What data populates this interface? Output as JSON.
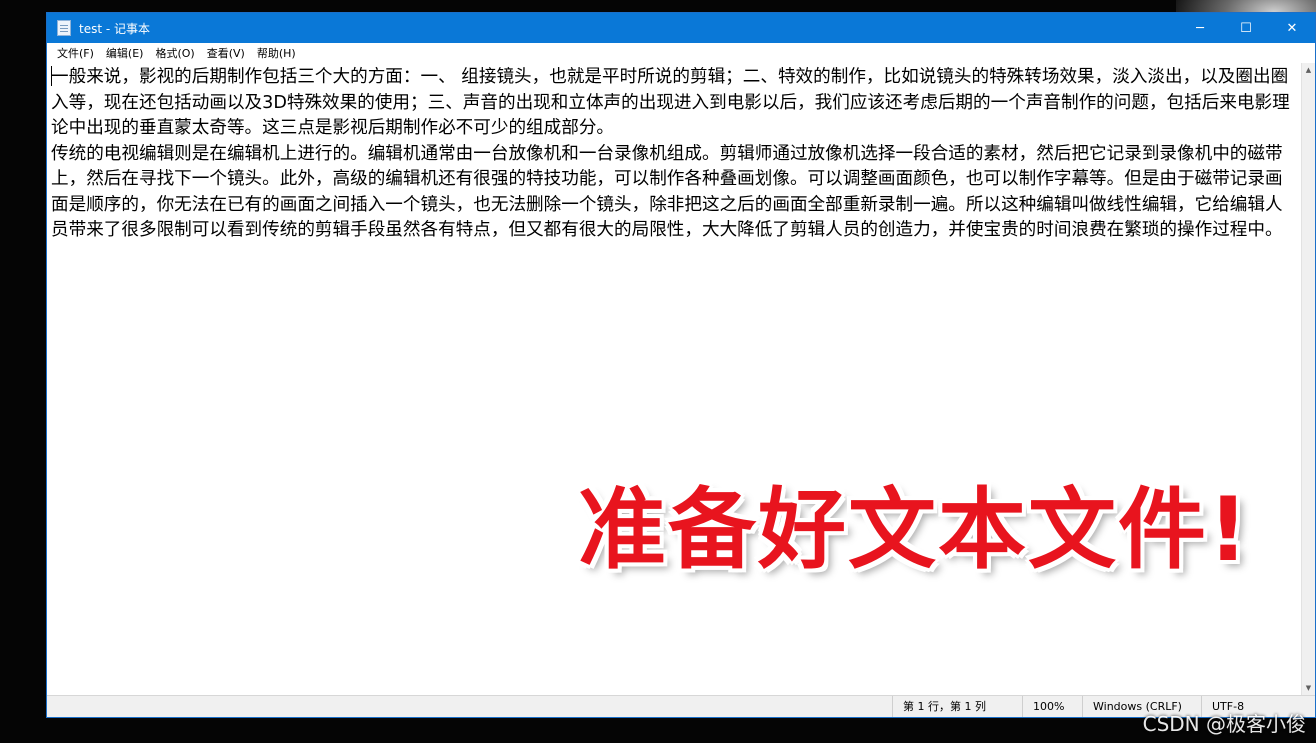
{
  "window": {
    "title": "test - 记事本",
    "controls": {
      "minimize": "─",
      "maximize": "☐",
      "close": "✕"
    }
  },
  "menu": [
    "文件(F)",
    "编辑(E)",
    "格式(O)",
    "查看(V)",
    "帮助(H)"
  ],
  "document": {
    "paragraphs": [
      "一般来说，影视的后期制作包括三个大的方面：一、 组接镜头，也就是平时所说的剪辑；二、特效的制作，比如说镜头的特殊转场效果，淡入淡出，以及圈出圈入等，现在还包括动画以及3D特殊效果的使用；三、声音的出现和立体声的出现进入到电影以后，我们应该还考虑后期的一个声音制作的问题，包括后来电影理论中出现的垂直蒙太奇等。这三点是影视后期制作必不可少的组成部分。",
      "传统的电视编辑则是在编辑机上进行的。编辑机通常由一台放像机和一台录像机组成。剪辑师通过放像机选择一段合适的素材，然后把它记录到录像机中的磁带上，然后在寻找下一个镜头。此外，高级的编辑机还有很强的特技功能，可以制作各种叠画划像。可以调整画面颜色，也可以制作字幕等。但是由于磁带记录画面是顺序的，你无法在已有的画面之间插入一个镜头，也无法删除一个镜头，除非把这之后的画面全部重新录制一遍。所以这种编辑叫做线性编辑，它给编辑人员带来了很多限制可以看到传统的剪辑手段虽然各有特点，但又都有很大的局限性，大大降低了剪辑人员的创造力，并使宝贵的时间浪费在繁琐的操作过程中。"
    ]
  },
  "status": {
    "position": "第 1 行，第 1 列",
    "zoom": "100%",
    "line_ending": "Windows (CRLF)",
    "encoding": "UTF-8"
  },
  "overlay": {
    "caption": "准备好文本文件!"
  },
  "watermark": "CSDN @极客小俊",
  "colors": {
    "titlebar": "#0a78d7",
    "caption": "#e8141e"
  }
}
